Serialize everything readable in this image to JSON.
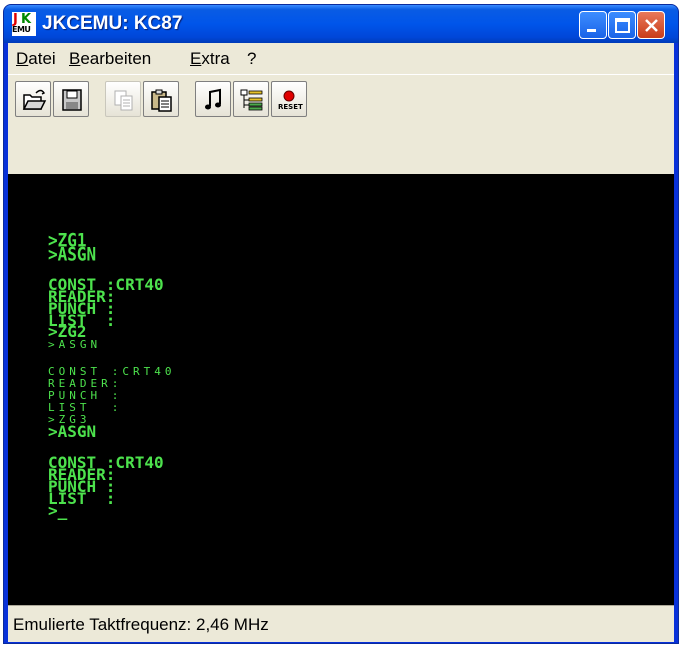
{
  "window": {
    "title": "JKCEMU: KC87",
    "app_icon": "jkcemu-logo-icon",
    "controls": [
      "minimize-icon",
      "maximize-icon",
      "close-icon"
    ]
  },
  "menubar": {
    "items": [
      {
        "label": "Datei",
        "mnemonic": "D",
        "rest": "atei"
      },
      {
        "label": "Bearbeiten",
        "mnemonic": "B",
        "rest": "earbeiten"
      },
      {
        "label": "Extra",
        "mnemonic": "E",
        "rest": "xtra"
      },
      {
        "label": "?",
        "mnemonic": "",
        "rest": "?"
      }
    ]
  },
  "toolbar": {
    "buttons": [
      {
        "name": "open-folder-icon",
        "enabled": true
      },
      {
        "name": "save-disk-icon",
        "enabled": true
      },
      {
        "name": "copy-icon",
        "enabled": false
      },
      {
        "name": "paste-icon",
        "enabled": true
      },
      {
        "name": "music-note-icon",
        "enabled": true
      },
      {
        "name": "tree-list-icon",
        "enabled": true
      },
      {
        "name": "reset-icon",
        "enabled": true,
        "label": "RESET"
      }
    ]
  },
  "terminal": {
    "text_color": "#4de24d",
    "background": "#000000",
    "lines": [
      ">ZG1",
      ">ASGN",
      "",
      "CONST :CRT40",
      "READER:",
      "PUNCH :",
      "LIST  :",
      ">ZG2",
      ">ASGN",
      "",
      "CONST :CRT40",
      "READER:",
      "PUNCH :",
      "LIST  :",
      ">ZG3",
      ">ASGN",
      "",
      "CONST :CRT40",
      "READER:",
      "PUNCH :",
      "LIST  :",
      ">_"
    ]
  },
  "statusbar": {
    "text": "Emulierte Taktfrequenz: 2,46 MHz"
  }
}
